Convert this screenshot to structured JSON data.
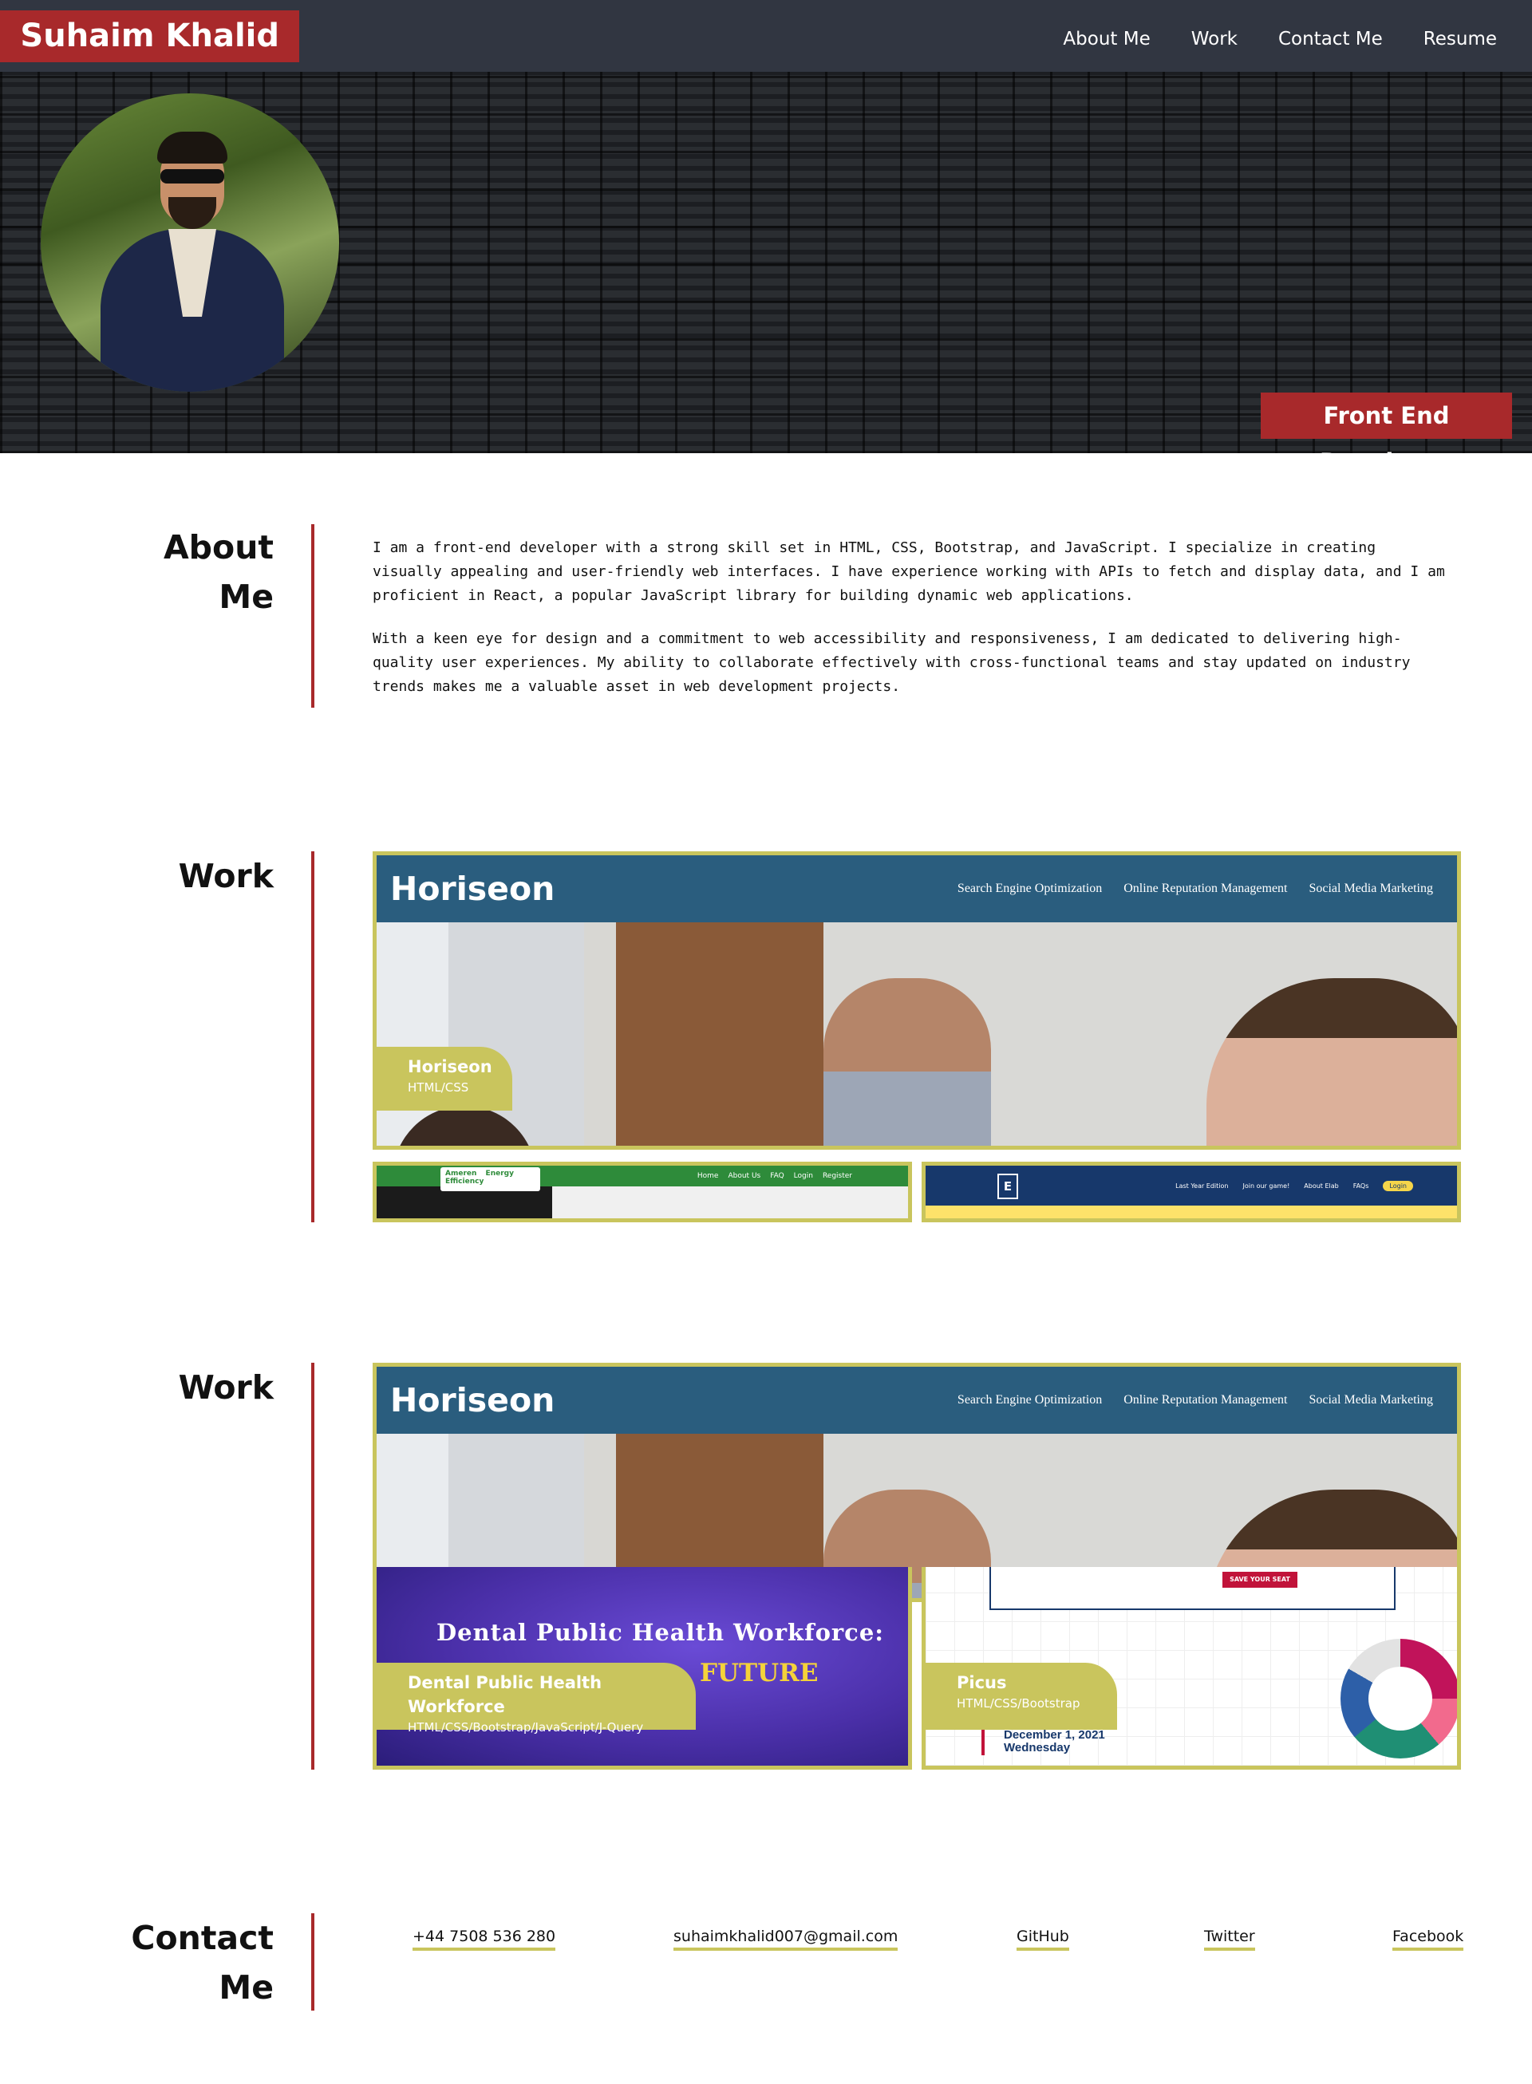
{
  "header": {
    "brand": "Suhaim Khalid",
    "nav": [
      "About Me",
      "Work",
      "Contact Me",
      "Resume"
    ]
  },
  "hero": {
    "role": "Front End Developer"
  },
  "about": {
    "heading_line1": "About",
    "heading_line2": "Me",
    "paragraphs": [
      "I am a front-end developer with a strong skill set in HTML, CSS, Bootstrap, and JavaScript. I specialize in creating visually appealing and user-friendly web interfaces. I have experience working with APIs to fetch and display data, and I am proficient in React, a popular JavaScript library for building dynamic web applications.",
      "With a keen eye for design and a commitment to web accessibility and responsiveness, I am dedicated to delivering high-quality user experiences. My ability to collaborate effectively with cross-functional teams and stay updated on industry trends makes me a valuable asset in web development projects."
    ]
  },
  "work": {
    "heading": "Work",
    "horiseon": {
      "logo": "Horiseon",
      "nav": [
        "Search Engine Optimization",
        "Online Reputation Management",
        "Social Media Marketing"
      ],
      "title": "Horiseon",
      "tech": "HTML/CSS"
    },
    "ameren": {
      "logo": "Ameren",
      "badge": "Energy Efficiency",
      "nav": [
        "Home",
        "About Us",
        "FAQ",
        "Login",
        "Register"
      ]
    },
    "elab": {
      "nav": [
        "Last Year Edition",
        "Join our game!",
        "About Elab",
        "FAQs"
      ],
      "login": "Login"
    }
  },
  "work2": {
    "heading": "Work",
    "dental": {
      "banner_title": "Dental Public Health Workforce:",
      "banner_sub": "FUTURE",
      "title": "Dental Public Health Workforce",
      "tech": "HTML/CSS/Bootstrap/JavaScript/J-Query"
    },
    "picus": {
      "cta": "SAVE YOUR SEAT",
      "date_line1": "December 1, 2021",
      "date_line2": "Wednesday",
      "title": "Picus",
      "tech": "HTML/CSS/Bootstrap"
    }
  },
  "contact": {
    "heading_line1": "Contact",
    "heading_line2": "Me",
    "links": [
      "+44 7508 536 280",
      "suhaimkhalid007@gmail.com",
      "GitHub",
      "Twitter",
      "Facebook"
    ]
  },
  "colors": {
    "nav_bg": "#313641",
    "accent_red": "#a8292b",
    "accent_olive": "#c9c55d",
    "horiseon_blue": "#2a5d7e"
  }
}
